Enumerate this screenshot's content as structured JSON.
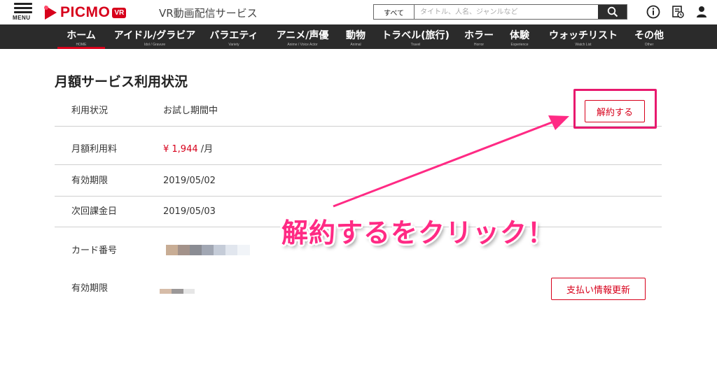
{
  "header": {
    "menu_label": "MENU",
    "logo_text": "PICMO",
    "logo_badge": "VR",
    "service_name": "VR動画配信サービス",
    "search": {
      "category": "すべて",
      "placeholder": "タイトル、人名、ジャンルなど"
    },
    "icons": [
      "search-icon",
      "info-icon",
      "history-icon",
      "user-icon"
    ],
    "brand_color": "#d7001b"
  },
  "nav": {
    "items": [
      {
        "label": "ホーム",
        "sub": "HOME",
        "active": true
      },
      {
        "label": "アイドル/グラビア",
        "sub": "Idol / Gravure"
      },
      {
        "label": "バラエティ",
        "sub": "Variety"
      },
      {
        "label": "アニメ/声優",
        "sub": "Anime / Voice Actor"
      },
      {
        "label": "動物",
        "sub": "Animal"
      },
      {
        "label": "トラベル(旅行)",
        "sub": "Travel"
      },
      {
        "label": "ホラー",
        "sub": "Horror"
      },
      {
        "label": "体験",
        "sub": "Experience"
      },
      {
        "label": "ウォッチリスト",
        "sub": "Watch List"
      },
      {
        "label": "その他",
        "sub": "Other"
      }
    ]
  },
  "main": {
    "title": "月額サービス利用状況",
    "rows": [
      {
        "label": "利用状況",
        "value": "お試し期間中"
      },
      {
        "label": "月額利用料",
        "price": "¥ 1,944",
        "unit": " /月"
      },
      {
        "label": "有効期限",
        "value": "2019/05/02"
      },
      {
        "label": "次回課金日",
        "value": "2019/05/03"
      },
      {
        "label": "カード番号"
      },
      {
        "label": "有効期限"
      }
    ],
    "cancel_button": "解約する",
    "update_payment_button": "支払い情報更新"
  },
  "annotation": {
    "text": "解約するをクリック！",
    "color": "#ff2a84"
  }
}
